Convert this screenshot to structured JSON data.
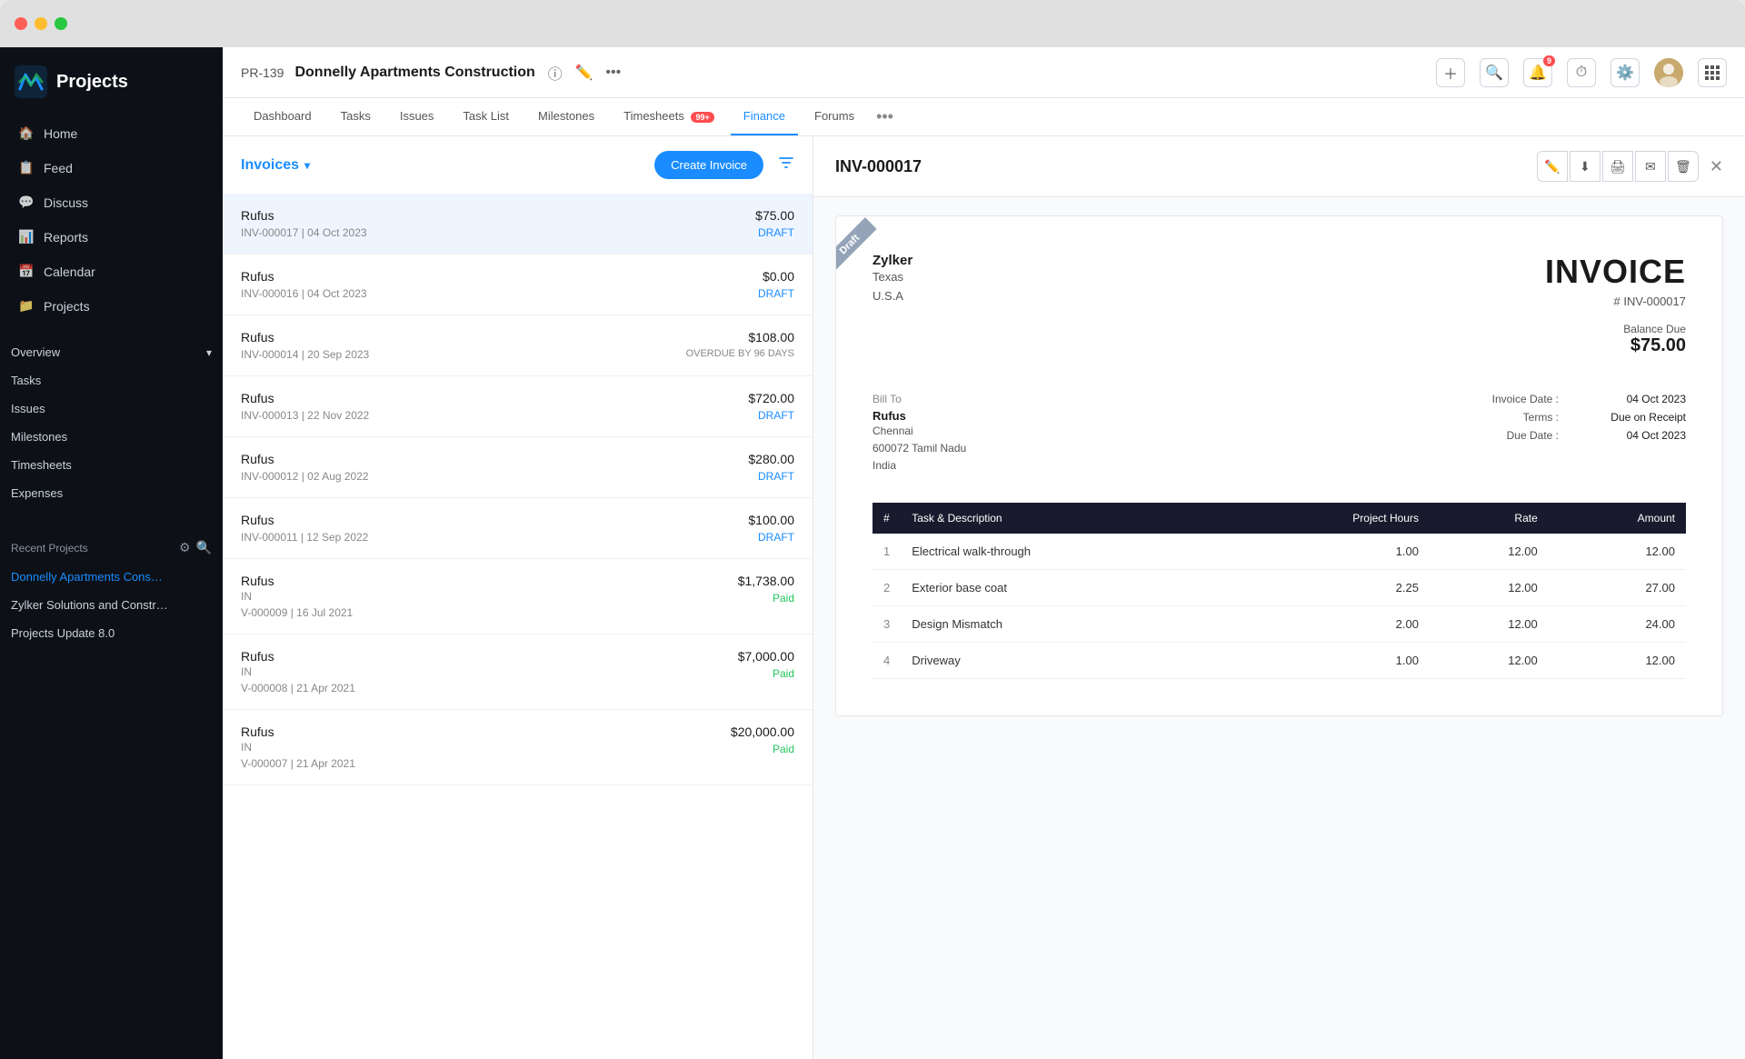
{
  "window": {
    "title": "Projects"
  },
  "sidebar": {
    "logo": "Projects",
    "nav_items": [
      {
        "id": "home",
        "label": "Home",
        "icon": "🏠"
      },
      {
        "id": "feed",
        "label": "Feed",
        "icon": "📋"
      },
      {
        "id": "discuss",
        "label": "Discuss",
        "icon": "💬"
      },
      {
        "id": "reports",
        "label": "Reports",
        "icon": "📊"
      },
      {
        "id": "calendar",
        "label": "Calendar",
        "icon": "📅"
      },
      {
        "id": "projects",
        "label": "Projects",
        "icon": "📁"
      }
    ],
    "overview_label": "Overview",
    "sub_items": [
      {
        "id": "tasks",
        "label": "Tasks"
      },
      {
        "id": "issues",
        "label": "Issues"
      },
      {
        "id": "milestones",
        "label": "Milestones"
      },
      {
        "id": "timesheets",
        "label": "Timesheets"
      },
      {
        "id": "expenses",
        "label": "Expenses"
      }
    ],
    "recent_projects_label": "Recent Projects",
    "recent_projects": [
      {
        "id": "donnelly",
        "label": "Donnelly Apartments Cons…",
        "active": true
      },
      {
        "id": "zylker",
        "label": "Zylker Solutions and Constr…"
      },
      {
        "id": "update",
        "label": "Projects Update 8.0"
      }
    ]
  },
  "topbar": {
    "project_id": "PR-139",
    "project_name": "Donnelly Apartments Construction",
    "tabs": [
      {
        "id": "dashboard",
        "label": "Dashboard"
      },
      {
        "id": "tasks",
        "label": "Tasks"
      },
      {
        "id": "issues",
        "label": "Issues"
      },
      {
        "id": "task-list",
        "label": "Task List"
      },
      {
        "id": "milestones",
        "label": "Milestones"
      },
      {
        "id": "timesheets",
        "label": "Timesheets",
        "badge": "99+"
      },
      {
        "id": "finance",
        "label": "Finance",
        "active": true
      },
      {
        "id": "forums",
        "label": "Forums"
      }
    ],
    "notif_badge": "9"
  },
  "invoice_list": {
    "title": "Invoices",
    "create_button": "Create Invoice",
    "items": [
      {
        "id": "inv17",
        "name": "Rufus",
        "meta": "INV-000017 | 04 Oct 2023",
        "amount": "$75.00",
        "status": "DRAFT",
        "status_type": "draft",
        "selected": true
      },
      {
        "id": "inv16",
        "name": "Rufus",
        "meta": "INV-000016 | 04 Oct 2023",
        "amount": "$0.00",
        "status": "DRAFT",
        "status_type": "draft"
      },
      {
        "id": "inv14",
        "name": "Rufus",
        "meta": "INV-000014 | 20 Sep 2023",
        "amount": "$108.00",
        "status": "OVERDUE BY 96 DAYS",
        "status_type": "overdue"
      },
      {
        "id": "inv13",
        "name": "Rufus",
        "meta": "INV-000013 | 22 Nov 2022",
        "amount": "$720.00",
        "status": "DRAFT",
        "status_type": "draft"
      },
      {
        "id": "inv12",
        "name": "Rufus",
        "meta": "INV-000012 | 02 Aug 2022",
        "amount": "$280.00",
        "status": "DRAFT",
        "status_type": "draft"
      },
      {
        "id": "inv11",
        "name": "Rufus",
        "meta": "INV-000011 | 12 Sep 2022",
        "amount": "$100.00",
        "status": "DRAFT",
        "status_type": "draft"
      },
      {
        "id": "inv9",
        "name": "Rufus",
        "name2": "IN",
        "meta": "V-000009 | 16 Jul 2021",
        "amount": "$1,738.00",
        "status": "Paid",
        "status_type": "paid"
      },
      {
        "id": "inv8",
        "name": "Rufus",
        "name2": "IN",
        "meta": "V-000008 | 21 Apr 2021",
        "amount": "$7,000.00",
        "status": "Paid",
        "status_type": "paid"
      },
      {
        "id": "inv7",
        "name": "Rufus",
        "name2": "IN",
        "meta": "V-000007 | 21 Apr 2021",
        "amount": "$20,000.00",
        "status": "Paid",
        "status_type": "paid"
      }
    ]
  },
  "invoice_detail": {
    "id": "INV-000017",
    "draft_label": "Draft",
    "company": {
      "name": "Zylker",
      "line1": "Texas",
      "line2": "U.S.A"
    },
    "heading": "INVOICE",
    "number_label": "# INV-000017",
    "balance_due_label": "Balance Due",
    "balance_amount": "$75.00",
    "bill_to_label": "Bill To",
    "bill_to_name": "Rufus",
    "bill_to_line1": "Chennai",
    "bill_to_line2": "600072 Tamil Nadu",
    "bill_to_line3": "India",
    "invoice_date_label": "Invoice Date :",
    "invoice_date_value": "04 Oct 2023",
    "terms_label": "Terms :",
    "terms_value": "Due on Receipt",
    "due_date_label": "Due Date :",
    "due_date_value": "04 Oct 2023",
    "table_headers": [
      "#",
      "Task & Description",
      "Project Hours",
      "Rate",
      "Amount"
    ],
    "table_rows": [
      {
        "num": "1",
        "desc": "Electrical walk-through",
        "hours": "1.00",
        "rate": "12.00",
        "amount": "12.00"
      },
      {
        "num": "2",
        "desc": "Exterior base coat",
        "hours": "2.25",
        "rate": "12.00",
        "amount": "27.00"
      },
      {
        "num": "3",
        "desc": "Design Mismatch",
        "hours": "2.00",
        "rate": "12.00",
        "amount": "24.00"
      },
      {
        "num": "4",
        "desc": "Driveway",
        "hours": "1.00",
        "rate": "12.00",
        "amount": "12.00"
      }
    ]
  }
}
